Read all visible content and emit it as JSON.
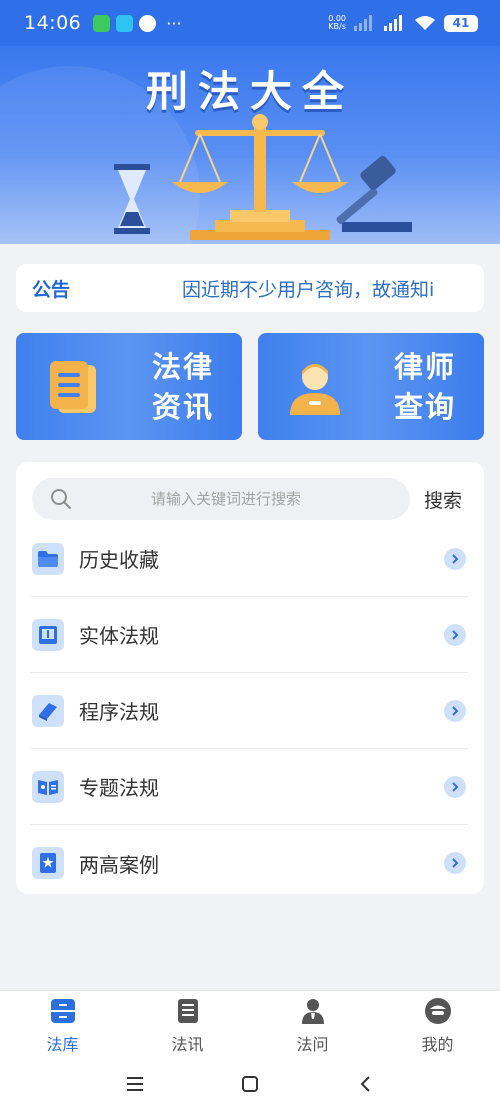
{
  "status_bar": {
    "time": "14:06",
    "more": "···",
    "speed_value": "0.00",
    "speed_unit": "KB/s",
    "battery": "41"
  },
  "banner": {
    "title": "刑法大全"
  },
  "notice": {
    "label": "公告",
    "text": "因近期不少用户咨询，故通知i"
  },
  "features": [
    {
      "label": "法律资讯",
      "icon": "news-icon",
      "color": "#f4b24a"
    },
    {
      "label": "律师查询",
      "icon": "lawyer-icon",
      "color": "#f4b24a"
    }
  ],
  "search": {
    "placeholder": "请输入关键词进行搜索",
    "button": "搜索"
  },
  "menu": [
    {
      "label": "历史收藏",
      "icon": "folder-icon"
    },
    {
      "label": "实体法规",
      "icon": "book-icon"
    },
    {
      "label": "程序法规",
      "icon": "closed-book-icon"
    },
    {
      "label": "专题法规",
      "icon": "open-book-icon"
    },
    {
      "label": "两高案例",
      "icon": "bookmark-star-icon"
    }
  ],
  "bottom_nav": [
    {
      "label": "法库",
      "icon": "law-library-icon",
      "active": true
    },
    {
      "label": "法讯",
      "icon": "law-news-icon",
      "active": false
    },
    {
      "label": "法问",
      "icon": "law-question-icon",
      "active": false
    },
    {
      "label": "我的",
      "icon": "profile-icon",
      "active": false
    }
  ],
  "colors": {
    "primary": "#2f6fe8",
    "accent": "#f4b24a",
    "active_tab": "#2e6fe0"
  }
}
